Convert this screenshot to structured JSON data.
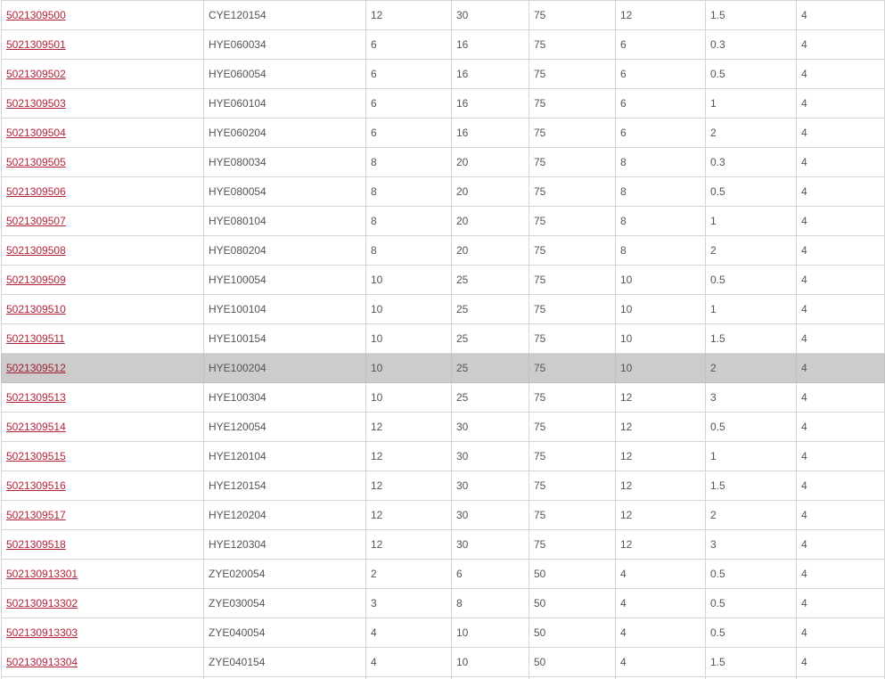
{
  "table": {
    "highlighted_row": 12,
    "rows": [
      [
        "5021309500",
        "CYE120154",
        "12",
        "30",
        "75",
        "12",
        "1.5",
        "4"
      ],
      [
        "5021309501",
        "HYE060034",
        "6",
        "16",
        "75",
        "6",
        "0.3",
        "4"
      ],
      [
        "5021309502",
        "HYE060054",
        "6",
        "16",
        "75",
        "6",
        "0.5",
        "4"
      ],
      [
        "5021309503",
        "HYE060104",
        "6",
        "16",
        "75",
        "6",
        "1",
        "4"
      ],
      [
        "5021309504",
        "HYE060204",
        "6",
        "16",
        "75",
        "6",
        "2",
        "4"
      ],
      [
        "5021309505",
        "HYE080034",
        "8",
        "20",
        "75",
        "8",
        "0.3",
        "4"
      ],
      [
        "5021309506",
        "HYE080054",
        "8",
        "20",
        "75",
        "8",
        "0.5",
        "4"
      ],
      [
        "5021309507",
        "HYE080104",
        "8",
        "20",
        "75",
        "8",
        "1",
        "4"
      ],
      [
        "5021309508",
        "HYE080204",
        "8",
        "20",
        "75",
        "8",
        "2",
        "4"
      ],
      [
        "5021309509",
        "HYE100054",
        "10",
        "25",
        "75",
        "10",
        "0.5",
        "4"
      ],
      [
        "5021309510",
        "HYE100104",
        "10",
        "25",
        "75",
        "10",
        "1",
        "4"
      ],
      [
        "5021309511",
        "HYE100154",
        "10",
        "25",
        "75",
        "10",
        "1.5",
        "4"
      ],
      [
        "5021309512",
        "HYE100204",
        "10",
        "25",
        "75",
        "10",
        "2",
        "4"
      ],
      [
        "5021309513",
        "HYE100304",
        "10",
        "25",
        "75",
        "12",
        "3",
        "4"
      ],
      [
        "5021309514",
        "HYE120054",
        "12",
        "30",
        "75",
        "12",
        "0.5",
        "4"
      ],
      [
        "5021309515",
        "HYE120104",
        "12",
        "30",
        "75",
        "12",
        "1",
        "4"
      ],
      [
        "5021309516",
        "HYE120154",
        "12",
        "30",
        "75",
        "12",
        "1.5",
        "4"
      ],
      [
        "5021309517",
        "HYE120204",
        "12",
        "30",
        "75",
        "12",
        "2",
        "4"
      ],
      [
        "5021309518",
        "HYE120304",
        "12",
        "30",
        "75",
        "12",
        "3",
        "4"
      ],
      [
        "502130913301",
        "ZYE020054",
        "2",
        "6",
        "50",
        "4",
        "0.5",
        "4"
      ],
      [
        "502130913302",
        "ZYE030054",
        "3",
        "8",
        "50",
        "4",
        "0.5",
        "4"
      ],
      [
        "502130913303",
        "ZYE040054",
        "4",
        "10",
        "50",
        "4",
        "0.5",
        "4"
      ],
      [
        "502130913304",
        "ZYE040154",
        "4",
        "10",
        "50",
        "4",
        "1.5",
        "4"
      ],
      [
        "",
        "",
        "",
        "",
        "",
        "",
        "",
        ""
      ]
    ]
  },
  "colors": {
    "link": "#b4243a",
    "text": "#555555",
    "border": "#d6d6d6",
    "highlight_bg": "#cccccc"
  }
}
